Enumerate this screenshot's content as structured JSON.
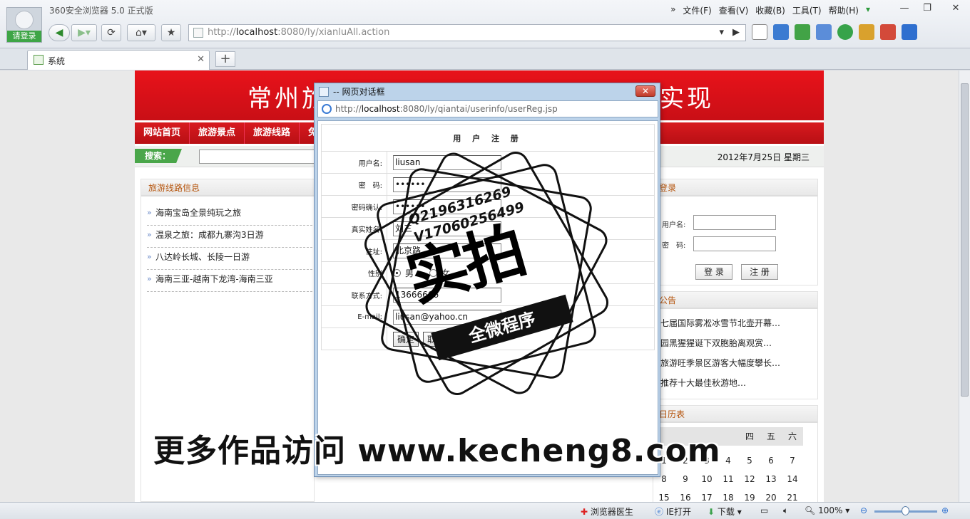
{
  "browser": {
    "app_title": "360安全浏览器 5.0 正式版",
    "login_label": "请登录",
    "menu": [
      "文件(F)",
      "查看(V)",
      "收藏(B)",
      "工具(T)",
      "帮助(H)"
    ],
    "address_prefix": "http://",
    "address_host": "localhost",
    "address_rest": ":8080/ly/xianluAll.action",
    "tab_title": "系统"
  },
  "site": {
    "banner_left": "常州旅",
    "banner_right": "实现",
    "nav": [
      "网站首页",
      "旅游景点",
      "旅游线路",
      "免"
    ],
    "search_label": "搜索：",
    "date": "2012年7月25日 星期三",
    "routes_title": "旅游线路信息",
    "routes": [
      "海南宝岛全景纯玩之旅",
      "温泉之旅：成都九寨沟3日游",
      "八达岭长城、长陵一日游",
      "海南三亚-越南下龙湾-海南三亚"
    ],
    "login_title": "登录",
    "login_user_label": "用户名:",
    "login_pass_label": "密　码:",
    "login_button": "登 录",
    "register_button": "注 册",
    "notice_title": "公告",
    "notices": [
      "七届国际雾凇冰雪节北壶开幕…",
      "园黑猩猩诞下双胞胎离观赏…",
      "旅游旺季景区游客大幅度攀长…",
      "推荐十大最佳秋游地…"
    ],
    "calendar_title": "日历表",
    "calendar_head": [
      "",
      "",
      "",
      "",
      "四",
      "五",
      "六"
    ],
    "calendar_rows": [
      [
        "1",
        "2",
        "3",
        "4",
        "5",
        "6",
        "7"
      ],
      [
        "8",
        "9",
        "10",
        "11",
        "12",
        "13",
        "14"
      ],
      [
        "15",
        "16",
        "17",
        "18",
        "19",
        "20",
        "21"
      ]
    ]
  },
  "dialog": {
    "title": "-- 网页对话框",
    "address_prefix": "http://",
    "address_host": "localhost",
    "address_rest": ":8080/ly/qiantai/userinfo/userReg.jsp",
    "form_title": "用 户 注 册",
    "fields": {
      "username_label": "用户名:",
      "username_value": "liusan",
      "password_label": "密　码:",
      "password_value": "••••••",
      "confirm_label": "密码确认:",
      "confirm_value": "••••••",
      "realname_label": "真实姓名:",
      "realname_value": "刘三",
      "address_label": "住址:",
      "address_value": "北京路",
      "gender_label": "性别",
      "gender_male": "男",
      "gender_female": "女",
      "phone_label": "联系方式:",
      "phone_value": "13666666",
      "email_label": "E-mail:",
      "email_value": "liusan@yahoo.cn"
    },
    "confirm_button": "确定",
    "cancel_button": "取消"
  },
  "watermark": {
    "qq": "Q2196316269",
    "vx": "V17060256499",
    "stamp_big": "实拍",
    "stamp_ribbon": "全微程序",
    "footer_text": "更多作品访问 www.kecheng8.com"
  },
  "status": {
    "doctor": "浏览器医生",
    "ie_open": "IE打开",
    "download": "下载",
    "zoom": "100%"
  }
}
